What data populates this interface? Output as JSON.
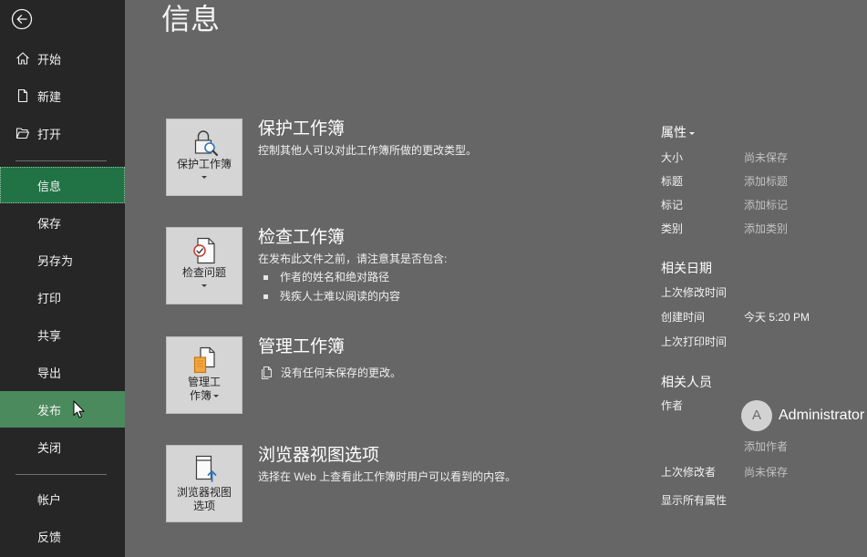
{
  "colors": {
    "sidebar_bg": "#262626",
    "main_bg": "#666666",
    "selected_bg": "#217346",
    "hover_bg": "#4a8a5c",
    "tile_bg": "#d5d5d5",
    "muted_text": "#c2c2c2"
  },
  "sidebar": {
    "back_icon": "back-arrow-icon",
    "top_items": [
      {
        "label": "开始",
        "icon": "home-icon"
      },
      {
        "label": "新建",
        "icon": "new-document-icon"
      },
      {
        "label": "打开",
        "icon": "open-folder-icon"
      }
    ],
    "items": [
      {
        "label": "信息",
        "selected": true
      },
      {
        "label": "保存"
      },
      {
        "label": "另存为"
      },
      {
        "label": "打印"
      },
      {
        "label": "共享"
      },
      {
        "label": "导出"
      },
      {
        "label": "发布",
        "hovered": true
      },
      {
        "label": "关闭"
      }
    ],
    "bottom_items": [
      {
        "label": "帐户"
      },
      {
        "label": "反馈"
      }
    ]
  },
  "main": {
    "title": "信息",
    "sections": [
      {
        "icon": "protect-workbook-icon",
        "button_lines": [
          "保护工作簿"
        ],
        "dropdown_icon": "dropdown-arrow-icon",
        "heading": "保护工作簿",
        "description": "控制其他人可以对此工作簿所做的更改类型。"
      },
      {
        "icon": "inspect-workbook-icon",
        "button_lines": [
          "检查问题"
        ],
        "dropdown_icon": "dropdown-arrow-icon",
        "heading": "检查工作簿",
        "description": "在发布此文件之前，请注意其是否包含:",
        "bullets": [
          "作者的姓名和绝对路径",
          "残疾人士难以阅读的内容"
        ]
      },
      {
        "icon": "manage-workbook-icon",
        "button_lines": [
          "管理工",
          "作簿"
        ],
        "dropdown_icon": "dropdown-arrow-icon",
        "heading": "管理工作簿",
        "status_icon": "document-status-icon",
        "description": "没有任何未保存的更改。"
      },
      {
        "icon": "browser-view-icon",
        "button_lines": [
          "浏览器视图",
          "选项"
        ],
        "heading": "浏览器视图选项",
        "description": "选择在 Web 上查看此工作簿时用户可以看到的内容。"
      }
    ]
  },
  "properties": {
    "heading": "属性",
    "rows": [
      {
        "label": "大小",
        "value": "尚未保存"
      },
      {
        "label": "标题",
        "value": "添加标题"
      },
      {
        "label": "标记",
        "value": "添加标记"
      },
      {
        "label": "类别",
        "value": "添加类别"
      }
    ],
    "dates_heading": "相关日期",
    "date_rows": [
      {
        "label": "上次修改时间"
      },
      {
        "label": "创建时间",
        "value": "今天 5:20 PM"
      },
      {
        "label": "上次打印时间"
      }
    ],
    "people_heading": "相关人员",
    "author_label": "作者",
    "author": {
      "initial": "A",
      "name": "Administrator"
    },
    "add_author": "添加作者",
    "last_modified_by_label": "上次修改者",
    "last_modified_by_value": "尚未保存",
    "show_all": "显示所有属性"
  },
  "cursor": {
    "icon": "mouse-pointer-icon"
  }
}
